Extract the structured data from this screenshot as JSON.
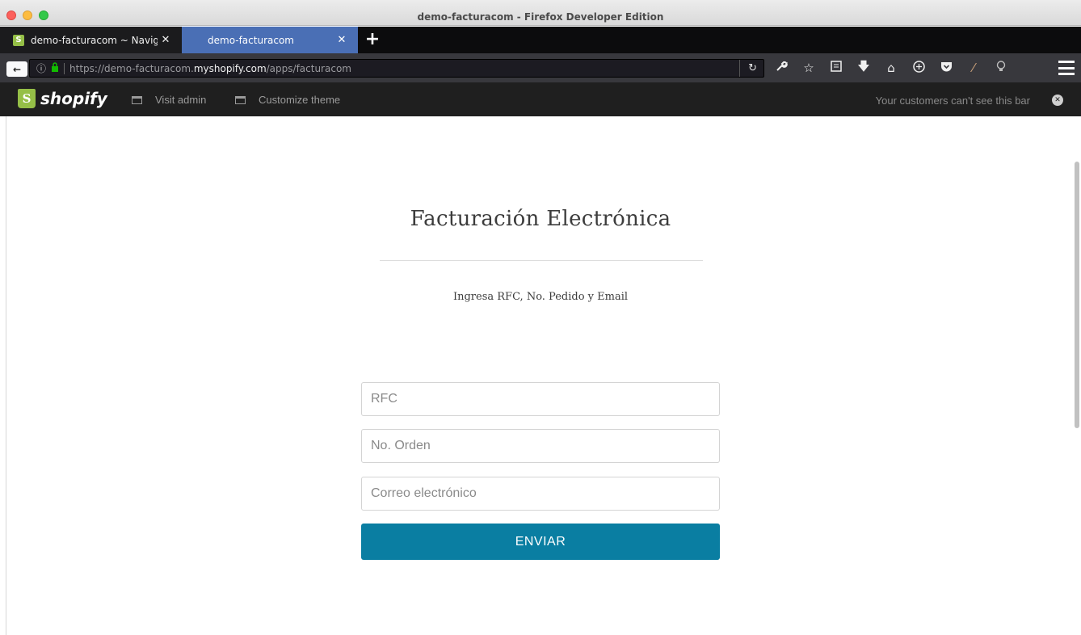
{
  "window": {
    "title": "demo-facturacom - Firefox Developer Edition"
  },
  "tabs": [
    {
      "label": "demo-facturacom ~ Navig...",
      "close": "✕",
      "favicon": "shopify-bag-icon"
    },
    {
      "label": "demo-facturacom",
      "close": "✕"
    }
  ],
  "newtab_label": "+",
  "navbar": {
    "back_label": "←",
    "url_prefix": "https://demo-facturacom.",
    "url_domain": "myshopify.com",
    "url_path": "/apps/facturacom",
    "info_icon": "ⓘ",
    "lock_icon": "🔒",
    "reload_label": "↻",
    "icons": [
      "wrench-icon",
      "star-icon",
      "reader-icon",
      "download-icon",
      "home-icon",
      "extension-icon",
      "pocket-icon",
      "feather-icon",
      "bulb-icon",
      "menu-icon"
    ]
  },
  "shopify_bar": {
    "logo_letter": "S",
    "logo_text": "shopify",
    "visit_admin": "Visit admin",
    "customize_theme": "Customize theme",
    "notice": "Your customers can't see this bar",
    "close": "✕"
  },
  "page": {
    "title": "Facturación Electrónica",
    "subtitle": "Ingresa RFC, No. Pedido y Email",
    "fields": {
      "rfc_placeholder": "RFC",
      "order_placeholder": "No. Orden",
      "email_placeholder": "Correo electrónico"
    },
    "submit_label": "ENVIAR"
  },
  "colors": {
    "button": "#0a7ea2",
    "active_tab": "#4a6fb5",
    "shopify_green": "#95bf47"
  }
}
